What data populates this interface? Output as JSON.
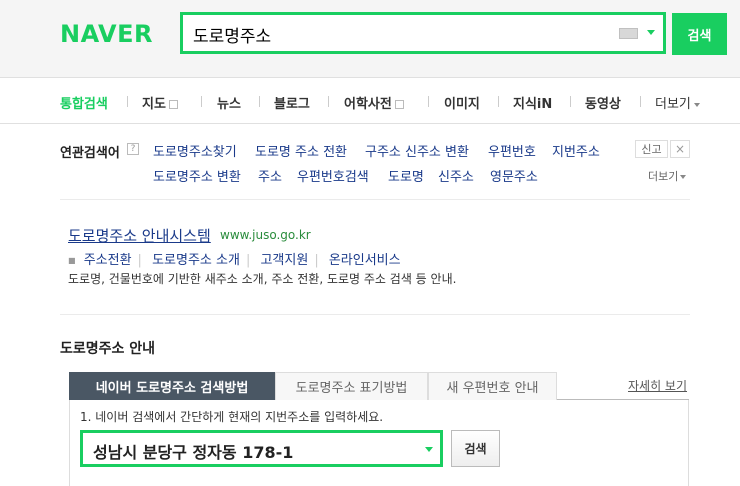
{
  "header": {
    "logo": "NAVER",
    "search_value": "도로명주소",
    "search_button": "검색"
  },
  "tabs": [
    {
      "label": "통합검색",
      "active": true
    },
    {
      "label": "지도"
    },
    {
      "label": "뉴스"
    },
    {
      "label": "블로그"
    },
    {
      "label": "어학사전"
    },
    {
      "label": "이미지"
    },
    {
      "label": "지식iN"
    },
    {
      "label": "동영상"
    },
    {
      "label": "더보기"
    }
  ],
  "related": {
    "title": "연관검색어",
    "help": "?",
    "row1": [
      "도로명주소찾기",
      "도로명 주소 전환",
      "구주소 신주소 변환",
      "우편번호",
      "지번주소"
    ],
    "row2": [
      "도로명주소 변환",
      "주소",
      "우편번호검색",
      "도로명",
      "신주소",
      "영문주소"
    ],
    "report": "신고",
    "close": "×",
    "more": "더보기"
  },
  "site": {
    "title": "도로명주소 안내시스템",
    "url": "www.juso.go.kr",
    "sublinks": [
      "주소전환",
      "도로명주소 소개",
      "고객지원",
      "온라인서비스"
    ],
    "desc": "도로명, 건물번호에 기반한 새주소 소개, 주소 전환, 도로명 주소 검색 등 안내."
  },
  "guide": {
    "title": "도로명주소 안내",
    "tabs": [
      "네이버 도로명주소 검색방법",
      "도로명주소 표기방법",
      "새 우편번호 안내"
    ],
    "more": "자세히 보기",
    "instruction": "1. 네이버 검색에서 간단하게 현재의 지번주소를 입력하세요.",
    "example_value": "성남시 분당구 정자동 178-1",
    "button": "검색"
  },
  "colors": {
    "brand": "#19ce60",
    "link": "#1a3a8a",
    "url": "#2a8c3c",
    "active_tab_bg": "#4a5764"
  }
}
